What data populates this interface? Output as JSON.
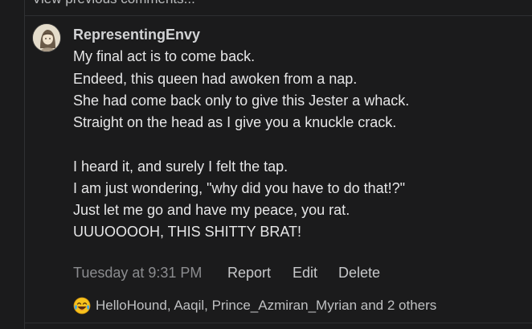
{
  "thread": {
    "view_previous_label": "View previous comments..."
  },
  "comment": {
    "author": "RepresentingEnvy",
    "body_lines": [
      "My final act is to come back.",
      "Endeed, this queen had awoken from a nap.",
      "She had come back only to give this Jester a whack.",
      "Straight on the head as I give you a knuckle crack.",
      "",
      "I heard it, and surely I felt the tap.",
      "I am just wondering, \"why did you have to do that!?\"",
      "Just let me go and have my peace, you rat.",
      "UUUOOOOH, THIS SHITTY BRAT!"
    ],
    "timestamp": "Tuesday at 9:31 PM",
    "actions": {
      "report_label": "Report",
      "edit_label": "Edit",
      "delete_label": "Delete"
    },
    "reactions": {
      "icon": "laughing-crying-emoji-icon",
      "summary": "HelloHound, Aaqil, Prince_Azmiran_Myrian and 2 others"
    }
  },
  "colors": {
    "background": "#1b1b1c",
    "text_primary": "#e6e6e7",
    "text_muted": "#8b8c8f",
    "username": "#d2d3d5",
    "divider": "#2e2f31"
  }
}
